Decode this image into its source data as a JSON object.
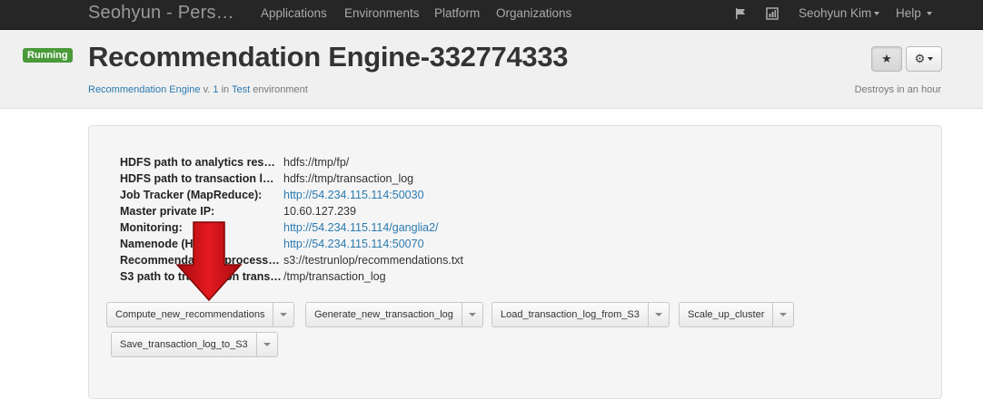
{
  "navbar": {
    "brand": "Seohyun - Pers…",
    "links": [
      "Applications",
      "Environments",
      "Platform",
      "Organizations"
    ],
    "user": "Seohyun Kim",
    "help": "Help",
    "icons": [
      "flag-icon",
      "chart-icon"
    ]
  },
  "header": {
    "status_badge": "Running",
    "title": "Recommendation Engine-332774333",
    "app_link": "Recommendation Engine",
    "version_prefix": "v.",
    "version": "1",
    "in_text": "in",
    "env_link": "Test",
    "env_suffix": "environment",
    "destroys": "Destroys in an hour",
    "star_icon": "star-icon",
    "gear_icon": "gear-icon"
  },
  "properties": [
    {
      "key": "HDFS path to analytics res…",
      "value": "hdfs://tmp/fp/",
      "link": false
    },
    {
      "key": "HDFS path to transaction l…",
      "value": "hdfs://tmp/transaction_log",
      "link": false
    },
    {
      "key": "Job Tracker (MapReduce):",
      "value": "http://54.234.115.114:50030",
      "link": true
    },
    {
      "key": "Master private IP:",
      "value": "10.60.127.239",
      "link": false
    },
    {
      "key": "Monitoring:",
      "value": "http://54.234.115.114/ganglia2/",
      "link": true
    },
    {
      "key": "Namenode (HDFS):",
      "value": "http://54.234.115.114:50070",
      "link": true
    },
    {
      "key": "Recommendations process…",
      "value": "s3://testrunlop/recommendations.txt",
      "link": false
    },
    {
      "key": "S3 path to transaction trans…",
      "value": "/tmp/transaction_log",
      "link": false
    }
  ],
  "actions": [
    {
      "label": "Compute_new_recommendations"
    },
    {
      "label": "Generate_new_transaction_log"
    },
    {
      "label": "Load_transaction_log_from_S3"
    },
    {
      "label": "Scale_up_cluster"
    },
    {
      "label": "Save_transaction_log_to_S3"
    }
  ],
  "colors": {
    "navbar_bg": "#262626",
    "running_badge": "#4a9a3a",
    "link": "#2a7ab0",
    "arrow_red": "#d2151b"
  }
}
